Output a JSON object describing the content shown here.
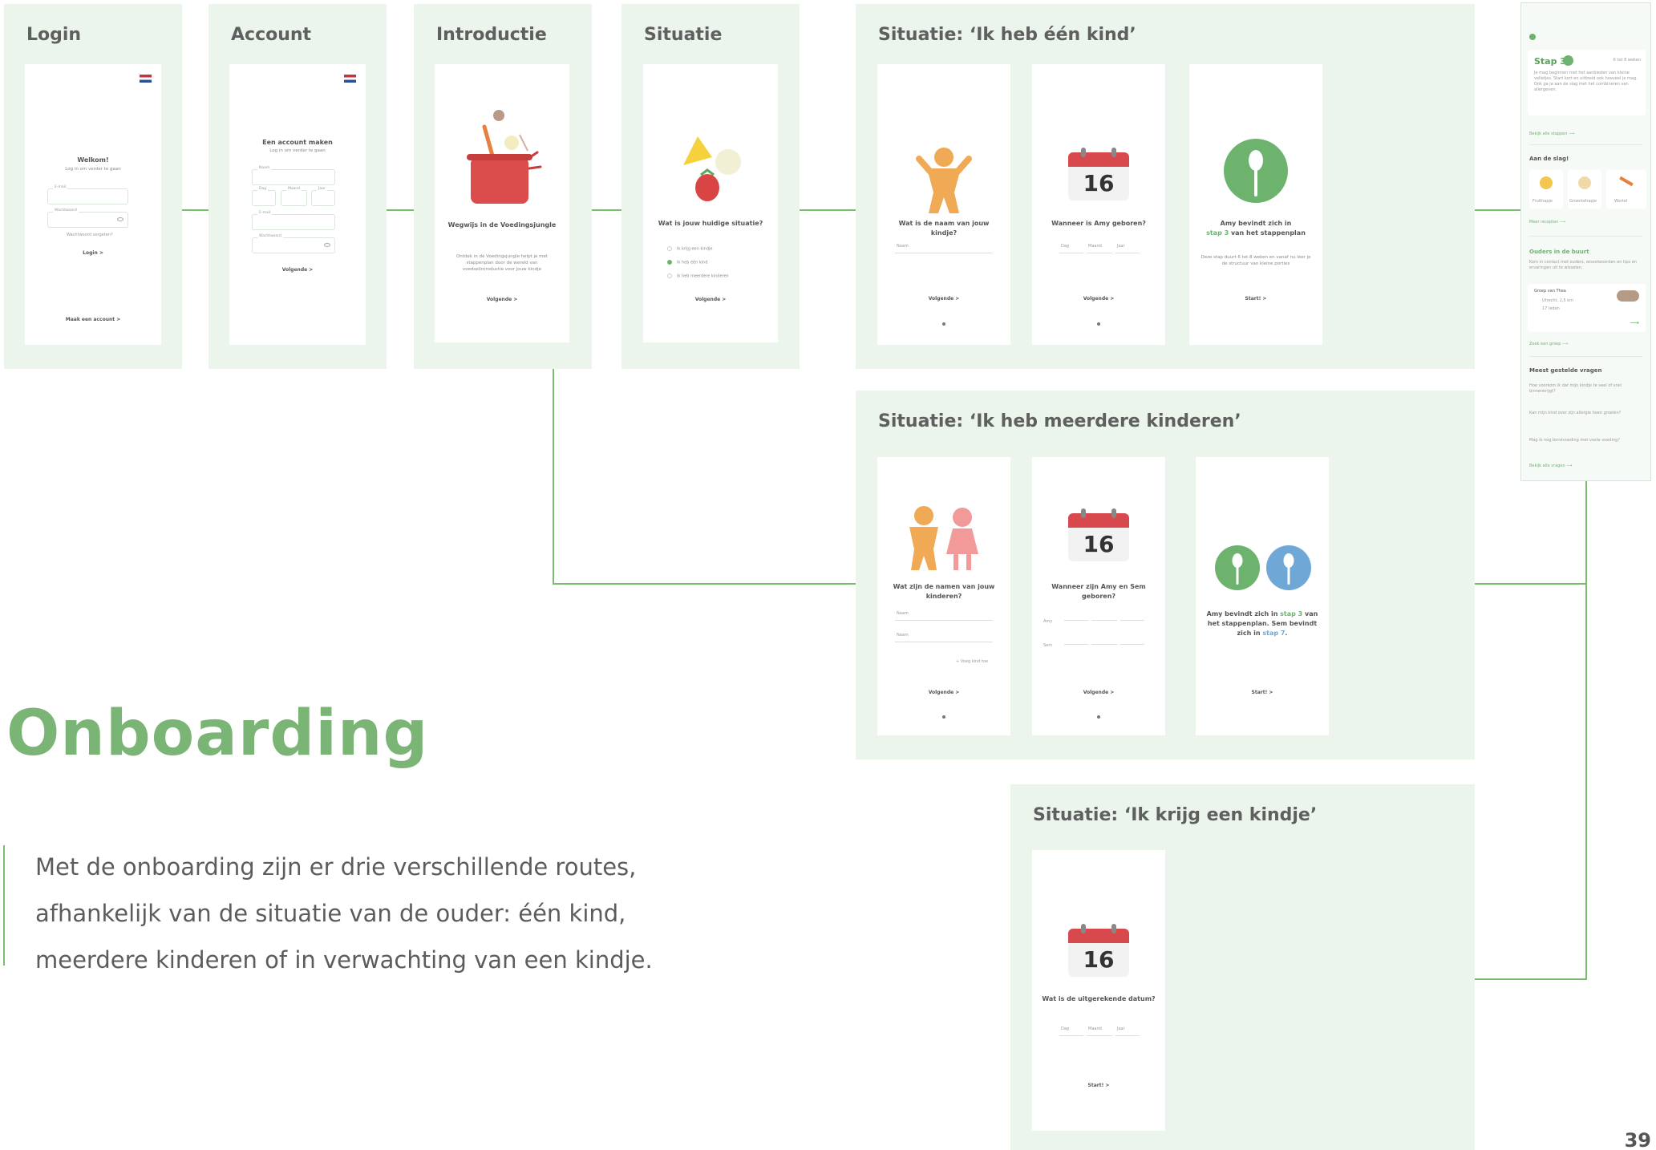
{
  "panels": {
    "login": "Login",
    "account": "Account",
    "intro": "Introductie",
    "situatie": "Situatie",
    "een_kind": "Situatie: ‘Ik heb één kind’",
    "meerdere": "Situatie: ‘Ik heb meerdere kinderen’",
    "kindje": "Situatie: ‘Ik krijg een kindje’"
  },
  "login_screen": {
    "title": "Welkom!",
    "subtitle": "Log in om verder te gaan",
    "email_label": "E-mail",
    "password_label": "Wachtwoord",
    "forgot": "Wachtwoord vergeten?",
    "login_button": "Login  >",
    "create_account": "Maak een account  >"
  },
  "account_screen": {
    "title": "Een account maken",
    "subtitle": "Log in om verder te gaan",
    "name_label": "Naam",
    "day_label": "Dag",
    "month_label": "Maand",
    "year_label": "Jaar",
    "email_label": "E-mail",
    "password_label": "Wachtwoord",
    "next_button": "Volgende  >"
  },
  "intro_screen": {
    "title": "Wegwijs in de Voedingsjungle",
    "text": "Ontdek in de Voedingsjungle helpt je met stappenplan door de wereld van voedselintroductie voor jouw kindje",
    "next_button": "Volgende  >"
  },
  "situatie_screen": {
    "title": "Wat is jouw huidige situatie?",
    "options": [
      "Ik krijg een kindje",
      "Ik heb één kind",
      "Ik heb meerdere kinderen"
    ],
    "next_button": "Volgende  >"
  },
  "een_kind": {
    "s1_title": "Wat is de naam van jouw kindje?",
    "s1_field": "Naam",
    "s1_button": "Volgende  >",
    "s2_day": "16",
    "s2_title": "Wanneer is Amy geboren?",
    "s2_fields": [
      "Dag",
      "Maand",
      "Jaar"
    ],
    "s2_button": "Volgende  >",
    "s3_title_a": "Amy bevindt zich in",
    "s3_title_b": "stap 3",
    "s3_title_c": " van het stappenplan",
    "s3_text": "Deze stap duurt 6 tot 8 weken en vanaf nu leer je de structuur van kleine porties",
    "s3_button": "Start!  >"
  },
  "meerdere": {
    "s1_title": "Wat zijn de namen van jouw kinderen?",
    "s1_fields": [
      "Naam",
      "Naam"
    ],
    "s1_add": "+ Voeg kind toe",
    "s1_button": "Volgende  >",
    "s2_day": "16",
    "s2_title": "Wanneer zijn Amy en Sem geboren?",
    "s2_names": [
      "Amy",
      "Sem"
    ],
    "s2_button": "Volgende  >",
    "s3_title_a": "Amy bevindt zich in ",
    "s3_step_a": "stap 3",
    "s3_title_b": " van het stappenplan. Sem bevindt zich in ",
    "s3_step_b": "stap 7",
    "s3_title_c": ".",
    "s3_button": "Start!  >"
  },
  "kindje": {
    "day": "16",
    "title": "Wat is de uitgerekende datum?",
    "fields": [
      "Dag",
      "Maand",
      "Jaar"
    ],
    "button": "Start!  >"
  },
  "dashboard": {
    "step_title": "Stap 3",
    "step_weeks": "6 tot 8 weken",
    "step_text": "Je mag beginnen met het aanbieden van kleine velletjes. Start kort en uitbreid ook hoeveel je mag. Ook ga je aan de slag met het combineren van allergenen.",
    "steps_link": "Bekijk alle stappen  ⟶",
    "recipes_head": "Aan de slag!",
    "recipes": [
      "Fruithapje",
      "Groentehapje",
      "Wortel"
    ],
    "recipes_link": "Meer recepten  ⟶",
    "parents_head": "Ouders in de buurt",
    "parents_text": "Kom in contact met ouders, wisselwoorden en tips en ervaringen uit te wisselen.",
    "group_name": "Groep van Thea",
    "group_place": "Utrecht, 2,5 km",
    "group_members": "17 leden",
    "group_link": "Zoek een groep  ⟶",
    "faq_head": "Meest gestelde vragen",
    "faq": [
      "Hoe voorkom ik dat mijn kindje te veel of snel binnenkrijgt?",
      "Kan mijn kind over zijn allergie heen groeien?",
      "Mag ik nog borstvoeding met vaste voeding?"
    ],
    "faq_link": "Bekijk alle vragen  ⟶"
  },
  "heading": "Onboarding",
  "description": [
    "Met de onboarding zijn er drie verschillende routes,",
    "afhankelijk van de situatie van de ouder: één kind,",
    "meerdere kinderen of in verwachting van een kindje."
  ],
  "page_number": "39",
  "colors": {
    "accent": "#7bbd6f",
    "panel": "#ebf5eb",
    "heading": "#7ab576",
    "calendar_red": "#d7494c",
    "spoon_green": "#6db36e",
    "spoon_blue": "#6fa8d6"
  }
}
